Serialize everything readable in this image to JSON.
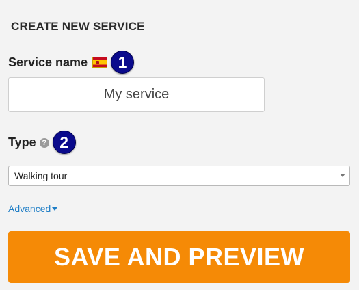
{
  "page": {
    "title": "CREATE NEW SERVICE"
  },
  "service_name": {
    "label": "Service name",
    "language_flag_icon": "spain-flag-icon",
    "step_number": "1",
    "value": "My service"
  },
  "type": {
    "label": "Type",
    "help_icon": "question-mark-icon",
    "help_glyph": "?",
    "step_number": "2",
    "selected": "Walking tour"
  },
  "advanced": {
    "label": "Advanced"
  },
  "save_button": {
    "label": "SAVE AND PREVIEW"
  },
  "colors": {
    "background": "#f3f3f3",
    "accent_orange": "#f58a06",
    "link_blue": "#1f7ec6",
    "step_badge": "#0a0a8c"
  }
}
